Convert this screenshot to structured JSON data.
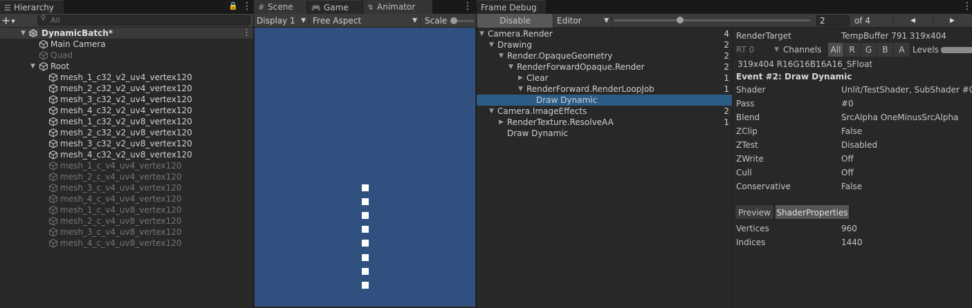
{
  "hierarchy": {
    "tab_label": "Hierarchy",
    "add_label": "+",
    "search_placeholder": "All",
    "scene_name": "DynamicBatch*",
    "items": [
      {
        "label": "Main Camera"
      },
      {
        "label": "Quad"
      },
      {
        "label": "Root"
      },
      {
        "label": "mesh_1_c32_v2_uv4_vertex120"
      },
      {
        "label": "mesh_2_c32_v2_uv4_vertex120"
      },
      {
        "label": "mesh_3_c32_v2_uv4_vertex120"
      },
      {
        "label": "mesh_4_c32_v2_uv4_vertex120"
      },
      {
        "label": "mesh_1_c32_v2_uv8_vertex120"
      },
      {
        "label": "mesh_2_c32_v2_uv8_vertex120"
      },
      {
        "label": "mesh_3_c32_v2_uv8_vertex120"
      },
      {
        "label": "mesh_4_c32_v2_uv8_vertex120"
      },
      {
        "label": "mesh_1_c_v4_uv4_vertex120"
      },
      {
        "label": "mesh_2_c_v4_uv4_vertex120"
      },
      {
        "label": "mesh_3_c_v4_uv4_vertex120"
      },
      {
        "label": "mesh_4_c_v4_uv4_vertex120"
      },
      {
        "label": "mesh_1_c_v4_uv8_vertex120"
      },
      {
        "label": "mesh_2_c_v4_uv8_vertex120"
      },
      {
        "label": "mesh_3_c_v4_uv8_vertex120"
      },
      {
        "label": "mesh_4_c_v4_uv8_vertex120"
      }
    ]
  },
  "game": {
    "tabs": [
      "Scene",
      "Game",
      "Animator"
    ],
    "display": "Display 1",
    "aspect": "Free Aspect",
    "scale_label": "Scale",
    "background": "#30507f"
  },
  "frame_debug": {
    "tab_label": "Frame Debug",
    "disable_label": "Disable",
    "source": "Editor",
    "event_index": "2",
    "event_total": "of 4",
    "prev_icon": "◀",
    "next_icon": "▶",
    "tree": [
      {
        "label": "Camera.Render",
        "count": "4"
      },
      {
        "label": "Drawing",
        "count": "2"
      },
      {
        "label": "Render.OpaqueGeometry",
        "count": "2"
      },
      {
        "label": "RenderForwardOpaque.Render",
        "count": "2"
      },
      {
        "label": "Clear",
        "count": "1"
      },
      {
        "label": "RenderForward.RenderLoopJob",
        "count": "1"
      },
      {
        "label": "Draw Dynamic",
        "count": ""
      },
      {
        "label": "Camera.ImageEffects",
        "count": "2"
      },
      {
        "label": "RenderTexture.ResolveAA",
        "count": "1"
      },
      {
        "label": "Draw Dynamic",
        "count": ""
      }
    ],
    "render_target_label": "RenderTarget",
    "render_target_value": "TempBuffer 791 319x404",
    "rt_label": "RT 0",
    "channels_label": "Channels",
    "channels": [
      "All",
      "R",
      "G",
      "B",
      "A"
    ],
    "levels_label": "Levels",
    "format": "319x404 R16G16B16A16_SFloat",
    "event_title": "Event #2: Draw Dynamic",
    "props": [
      {
        "name": "Shader",
        "value": "Unlit/TestShader, SubShader #0"
      },
      {
        "name": "Pass",
        "value": "#0"
      },
      {
        "name": "Blend",
        "value": "SrcAlpha OneMinusSrcAlpha"
      },
      {
        "name": "ZClip",
        "value": "False"
      },
      {
        "name": "ZTest",
        "value": "Disabled"
      },
      {
        "name": "ZWrite",
        "value": "Off"
      },
      {
        "name": "Cull",
        "value": "Off"
      },
      {
        "name": "Conservative",
        "value": "False"
      }
    ],
    "subtabs": [
      "Preview",
      "ShaderProperties"
    ],
    "stats": [
      {
        "name": "Vertices",
        "value": "960"
      },
      {
        "name": "Indices",
        "value": "1440"
      }
    ]
  }
}
